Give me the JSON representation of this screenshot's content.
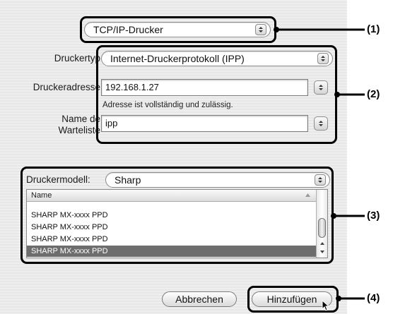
{
  "protocol_popup": {
    "value": "TCP/IP-Drucker"
  },
  "druckertyp": {
    "label": "Druckertyp",
    "value": "Internet-Druckerprotokoll (IPP)"
  },
  "druckeradresse": {
    "label": "Druckeradresse",
    "value": "192.168.1.27",
    "hint": "Adresse ist vollständig und zulässig."
  },
  "warteliste": {
    "label_line1": "Name de",
    "label_line2": "Warteliste",
    "value": "ipp"
  },
  "druckermodell": {
    "label": "Druckermodell:",
    "value": "Sharp"
  },
  "model_list": {
    "header": "Name",
    "rows": [
      {
        "text": "SHARP MX-xxxx PPD",
        "selected": false
      },
      {
        "text": "SHARP MX-xxxx PPD",
        "selected": false
      },
      {
        "text": "SHARP MX-xxxx PPD",
        "selected": false
      },
      {
        "text": "SHARP MX-xxxx PPD",
        "selected": true
      }
    ]
  },
  "buttons": {
    "cancel": "Abbrechen",
    "add": "Hinzufügen"
  },
  "callouts": {
    "c1": "(1)",
    "c2": "(2)",
    "c3": "(3)",
    "c4": "(4)"
  },
  "colors": {
    "selection": "#6d6d6d",
    "frame": "#000000"
  }
}
